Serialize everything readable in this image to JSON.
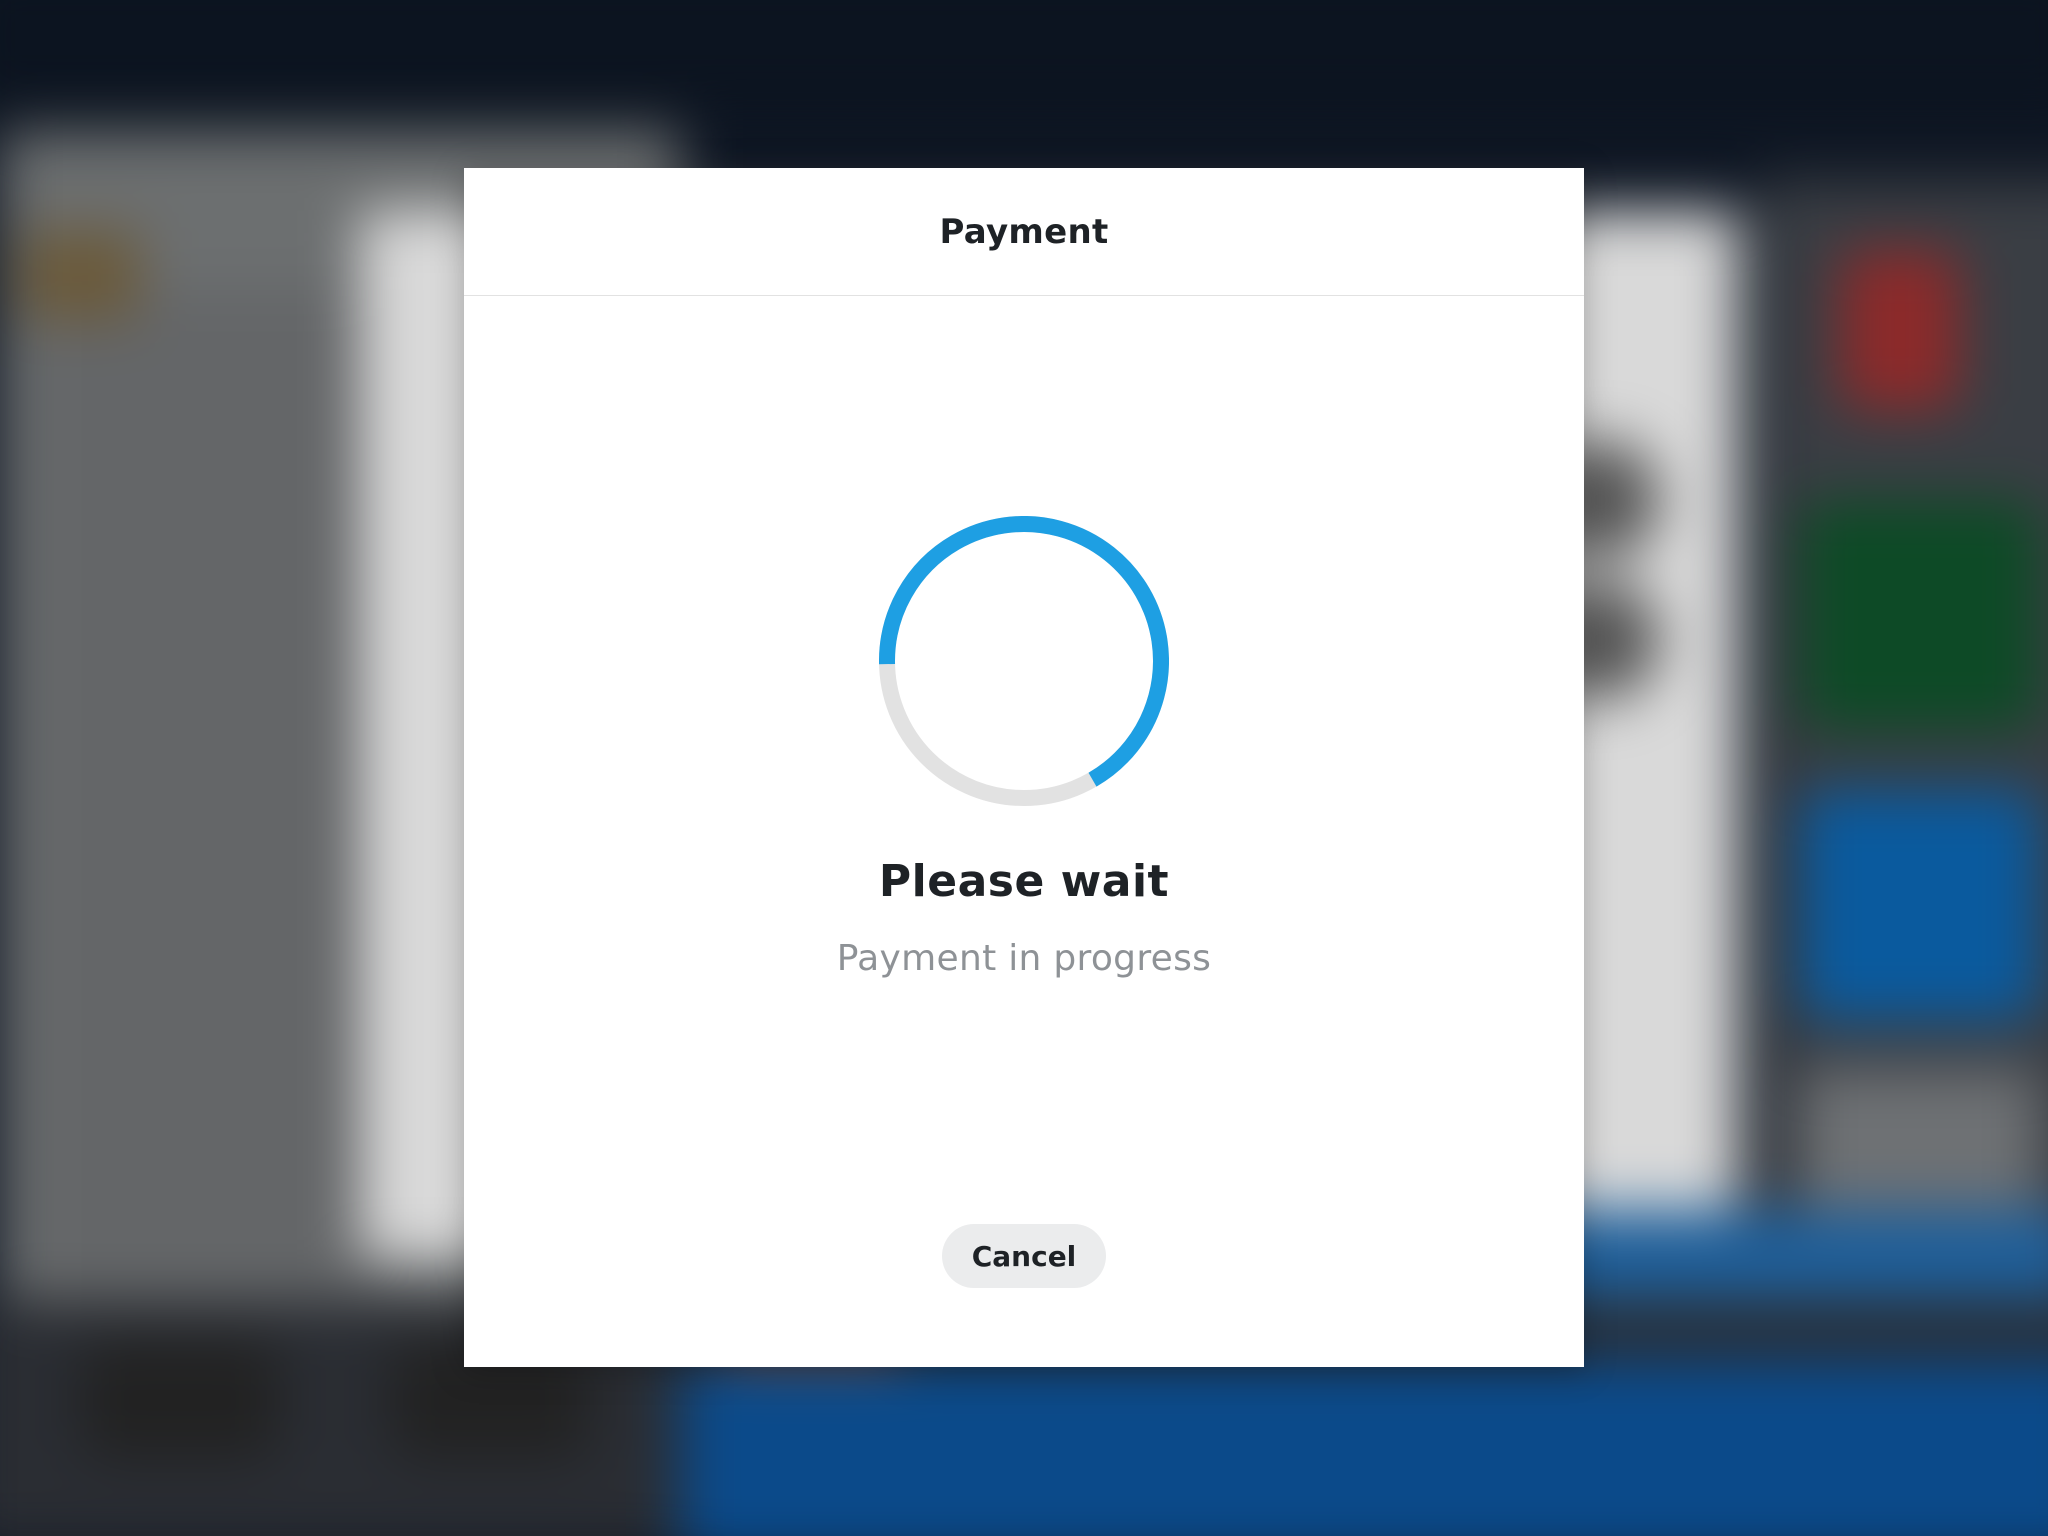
{
  "modal": {
    "title": "Payment",
    "status_title": "Please wait",
    "status_subtitle": "Payment in progress",
    "cancel_label": "Cancel"
  },
  "spinner": {
    "icon": "loading-spinner-icon",
    "progress": 0.67,
    "active_color": "#1e9fe3",
    "track_color": "#e2e2e2"
  },
  "colors": {
    "modal_background": "#ffffff",
    "text_primary": "#1e2226",
    "text_secondary": "#8e9296",
    "button_background": "#ebeced"
  }
}
